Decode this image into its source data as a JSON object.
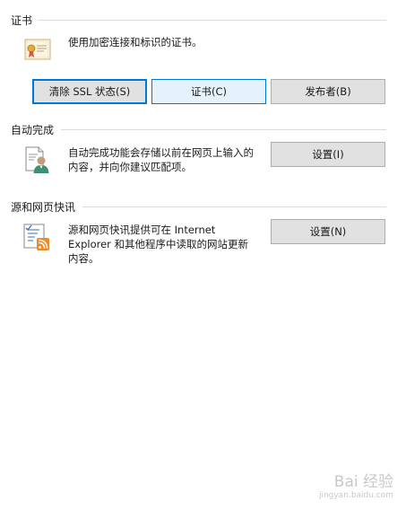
{
  "certificates": {
    "title": "证书",
    "description": "使用加密连接和标识的证书。",
    "clear_ssl_button": "清除 SSL 状态(S)",
    "certificates_button": "证书(C)",
    "publishers_button": "发布者(B)",
    "icon": "certificate-icon"
  },
  "autocomplete": {
    "title": "自动完成",
    "description_line1": "自动完成功能会存储以前在网页上输入的",
    "description_line2": "内容，并向你建议匹配项。",
    "settings_button": "设置(I)",
    "icon": "autocomplete-user-icon"
  },
  "feeds": {
    "title": "源和网页快讯",
    "description_line1": "源和网页快讯提供可在 Internet",
    "description_line2": "Explorer 和其他程序中读取的网站更新",
    "description_line3": "内容。",
    "settings_button": "设置(N)",
    "icon": "rss-feed-icon"
  },
  "watermark": {
    "text": "Bai 经验",
    "subtext": "jingyan.baidu.com"
  },
  "colors": {
    "accent": "#0078d7",
    "button_face": "#e1e1e1",
    "hover_face": "#e5f1fb"
  }
}
